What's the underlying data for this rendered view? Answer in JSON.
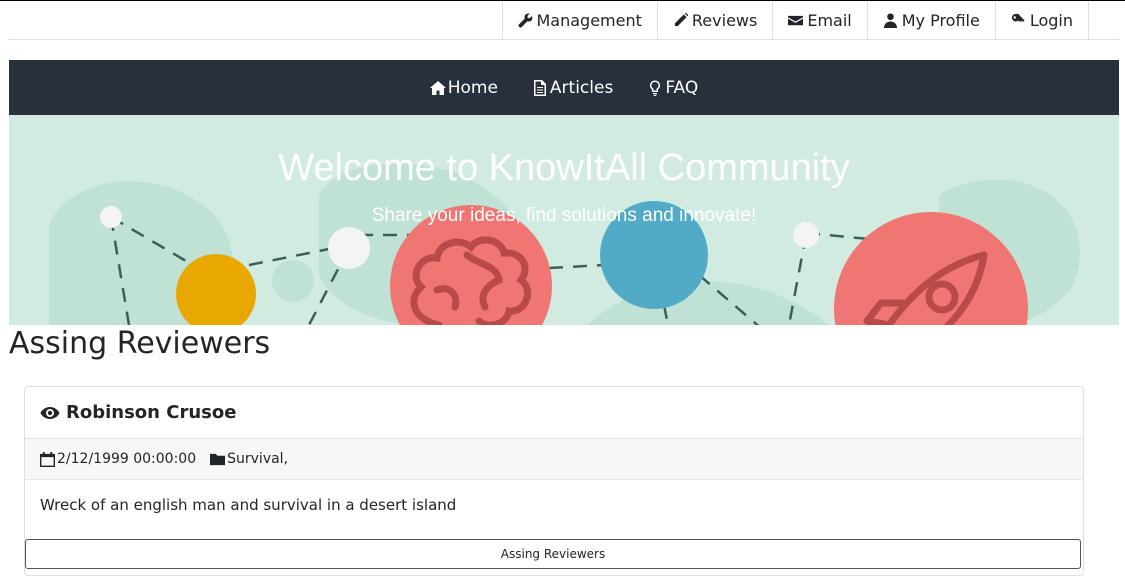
{
  "top_nav": {
    "items": [
      {
        "label": "Management",
        "icon": "wrench-icon"
      },
      {
        "label": "Reviews",
        "icon": "pencil-icon"
      },
      {
        "label": "Email",
        "icon": "envelope-icon"
      },
      {
        "label": "My Profile",
        "icon": "user-icon"
      },
      {
        "label": "Login",
        "icon": "key-icon"
      }
    ]
  },
  "main_nav": {
    "items": [
      {
        "label": "Home",
        "icon": "home-icon"
      },
      {
        "label": "Articles",
        "icon": "document-icon"
      },
      {
        "label": "FAQ",
        "icon": "lightbulb-icon"
      }
    ]
  },
  "banner": {
    "title": "Welcome to KnowItAll Community",
    "subtitle": "Share your ideas, find solutions and innovate!"
  },
  "page": {
    "title": "Assing Reviewers"
  },
  "article": {
    "title": "Robinson Crusoe",
    "title_icon": "eye-icon",
    "date": "2/12/1999 00:00:00",
    "date_icon": "calendar-icon",
    "category": "Survival,",
    "category_icon": "folder-icon",
    "description": "Wreck of an english man and survival in a desert island",
    "button_label": "Assing Reviewers"
  },
  "colors": {
    "main_nav_bg": "#27303b",
    "banner_bg": "#d2ebe1",
    "accent_yellow": "#e8a800",
    "accent_red": "#f07673",
    "accent_blue": "#52abc6"
  }
}
